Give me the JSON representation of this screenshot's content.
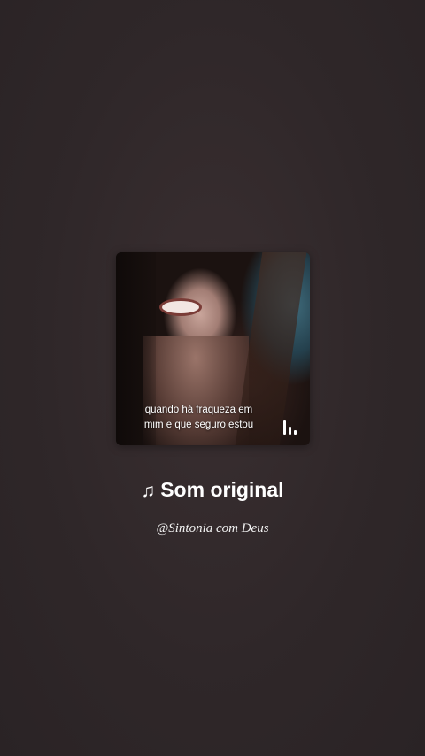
{
  "audio_card": {
    "caption_line1": "quando há fraqueza em",
    "caption_line2": "mim e que seguro estou",
    "icon": "audio-bars-icon"
  },
  "sound": {
    "note_icon": "♫",
    "title": "Som original",
    "author": "@Sintonia com Deus"
  }
}
